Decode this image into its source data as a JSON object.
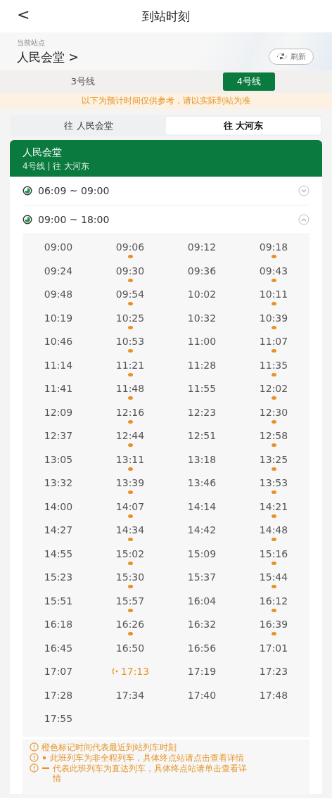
{
  "header": {
    "back": "<",
    "title": "到站时刻"
  },
  "station": {
    "caption": "当前站点",
    "name": "人民会堂",
    "chevron": ">",
    "refresh": "刷新"
  },
  "lines": [
    {
      "label": "3号线",
      "selected": false
    },
    {
      "label": "4号线",
      "selected": true
    }
  ],
  "notice": "以下为预计时间仅供参考，请以实际到站为准",
  "directions": [
    {
      "label": "往 人民会堂",
      "selected": false
    },
    {
      "label": "往 大河东",
      "selected": true
    }
  ],
  "card": {
    "station": "人民会堂",
    "subtitle": "4号线 | 往 大河东"
  },
  "periods": [
    {
      "range": "06:09 ~ 09:00",
      "expanded": false
    },
    {
      "range": "09:00 ~ 18:00",
      "expanded": true
    }
  ],
  "times": [
    {
      "time": "09:00",
      "partial": false,
      "next": false
    },
    {
      "time": "09:06",
      "partial": true,
      "next": false
    },
    {
      "time": "09:12",
      "partial": false,
      "next": false
    },
    {
      "time": "09:18",
      "partial": true,
      "next": false
    },
    {
      "time": "09:24",
      "partial": false,
      "next": false
    },
    {
      "time": "09:30",
      "partial": true,
      "next": false
    },
    {
      "time": "09:36",
      "partial": false,
      "next": false
    },
    {
      "time": "09:43",
      "partial": true,
      "next": false
    },
    {
      "time": "09:48",
      "partial": false,
      "next": false
    },
    {
      "time": "09:54",
      "partial": true,
      "next": false
    },
    {
      "time": "10:02",
      "partial": false,
      "next": false
    },
    {
      "time": "10:11",
      "partial": true,
      "next": false
    },
    {
      "time": "10:19",
      "partial": false,
      "next": false
    },
    {
      "time": "10:25",
      "partial": true,
      "next": false
    },
    {
      "time": "10:32",
      "partial": false,
      "next": false
    },
    {
      "time": "10:39",
      "partial": true,
      "next": false
    },
    {
      "time": "10:46",
      "partial": false,
      "next": false
    },
    {
      "time": "10:53",
      "partial": true,
      "next": false
    },
    {
      "time": "11:00",
      "partial": false,
      "next": false
    },
    {
      "time": "11:07",
      "partial": true,
      "next": false
    },
    {
      "time": "11:14",
      "partial": false,
      "next": false
    },
    {
      "time": "11:21",
      "partial": true,
      "next": false
    },
    {
      "time": "11:28",
      "partial": false,
      "next": false
    },
    {
      "time": "11:35",
      "partial": true,
      "next": false
    },
    {
      "time": "11:41",
      "partial": false,
      "next": false
    },
    {
      "time": "11:48",
      "partial": true,
      "next": false
    },
    {
      "time": "11:55",
      "partial": false,
      "next": false
    },
    {
      "time": "12:02",
      "partial": true,
      "next": false
    },
    {
      "time": "12:09",
      "partial": false,
      "next": false
    },
    {
      "time": "12:16",
      "partial": true,
      "next": false
    },
    {
      "time": "12:23",
      "partial": false,
      "next": false
    },
    {
      "time": "12:30",
      "partial": true,
      "next": false
    },
    {
      "time": "12:37",
      "partial": false,
      "next": false
    },
    {
      "time": "12:44",
      "partial": true,
      "next": false
    },
    {
      "time": "12:51",
      "partial": false,
      "next": false
    },
    {
      "time": "12:58",
      "partial": true,
      "next": false
    },
    {
      "time": "13:05",
      "partial": false,
      "next": false
    },
    {
      "time": "13:11",
      "partial": true,
      "next": false
    },
    {
      "time": "13:18",
      "partial": false,
      "next": false
    },
    {
      "time": "13:25",
      "partial": true,
      "next": false
    },
    {
      "time": "13:32",
      "partial": false,
      "next": false
    },
    {
      "time": "13:39",
      "partial": true,
      "next": false
    },
    {
      "time": "13:46",
      "partial": false,
      "next": false
    },
    {
      "time": "13:53",
      "partial": true,
      "next": false
    },
    {
      "time": "14:00",
      "partial": false,
      "next": false
    },
    {
      "time": "14:07",
      "partial": true,
      "next": false
    },
    {
      "time": "14:14",
      "partial": false,
      "next": false
    },
    {
      "time": "14:21",
      "partial": true,
      "next": false
    },
    {
      "time": "14:27",
      "partial": false,
      "next": false
    },
    {
      "time": "14:34",
      "partial": true,
      "next": false
    },
    {
      "time": "14:42",
      "partial": false,
      "next": false
    },
    {
      "time": "14:48",
      "partial": true,
      "next": false
    },
    {
      "time": "14:55",
      "partial": false,
      "next": false
    },
    {
      "time": "15:02",
      "partial": true,
      "next": false
    },
    {
      "time": "15:09",
      "partial": false,
      "next": false
    },
    {
      "time": "15:16",
      "partial": true,
      "next": false
    },
    {
      "time": "15:23",
      "partial": false,
      "next": false
    },
    {
      "time": "15:30",
      "partial": true,
      "next": false
    },
    {
      "time": "15:37",
      "partial": false,
      "next": false
    },
    {
      "time": "15:44",
      "partial": true,
      "next": false
    },
    {
      "time": "15:51",
      "partial": false,
      "next": false
    },
    {
      "time": "15:57",
      "partial": true,
      "next": false
    },
    {
      "time": "16:04",
      "partial": false,
      "next": false
    },
    {
      "time": "16:12",
      "partial": true,
      "next": false
    },
    {
      "time": "16:18",
      "partial": false,
      "next": false
    },
    {
      "time": "16:26",
      "partial": true,
      "next": false
    },
    {
      "time": "16:32",
      "partial": false,
      "next": false
    },
    {
      "time": "16:39",
      "partial": true,
      "next": false
    },
    {
      "time": "16:45",
      "partial": false,
      "next": false
    },
    {
      "time": "16:50",
      "partial": false,
      "next": false
    },
    {
      "time": "16:56",
      "partial": false,
      "next": false
    },
    {
      "time": "17:01",
      "partial": false,
      "next": false
    },
    {
      "time": "17:07",
      "partial": false,
      "next": false
    },
    {
      "time": "17:13",
      "partial": false,
      "next": true
    },
    {
      "time": "17:19",
      "partial": false,
      "next": false
    },
    {
      "time": "17:23",
      "partial": false,
      "next": false
    },
    {
      "time": "17:28",
      "partial": false,
      "next": false
    },
    {
      "time": "17:34",
      "partial": false,
      "next": false
    },
    {
      "time": "17:40",
      "partial": false,
      "next": false
    },
    {
      "time": "17:48",
      "partial": false,
      "next": false
    },
    {
      "time": "17:55",
      "partial": false,
      "next": false
    }
  ],
  "notes": [
    {
      "kind": "plain",
      "text": "橙色标记时间代表最近到站列车时刻"
    },
    {
      "kind": "dot",
      "text": "此班列车为非全程列车，具体终点站请点击查看详情"
    },
    {
      "kind": "dash",
      "text": "代表此班列车为直达列车，具体终点站请单击查看详情"
    }
  ]
}
